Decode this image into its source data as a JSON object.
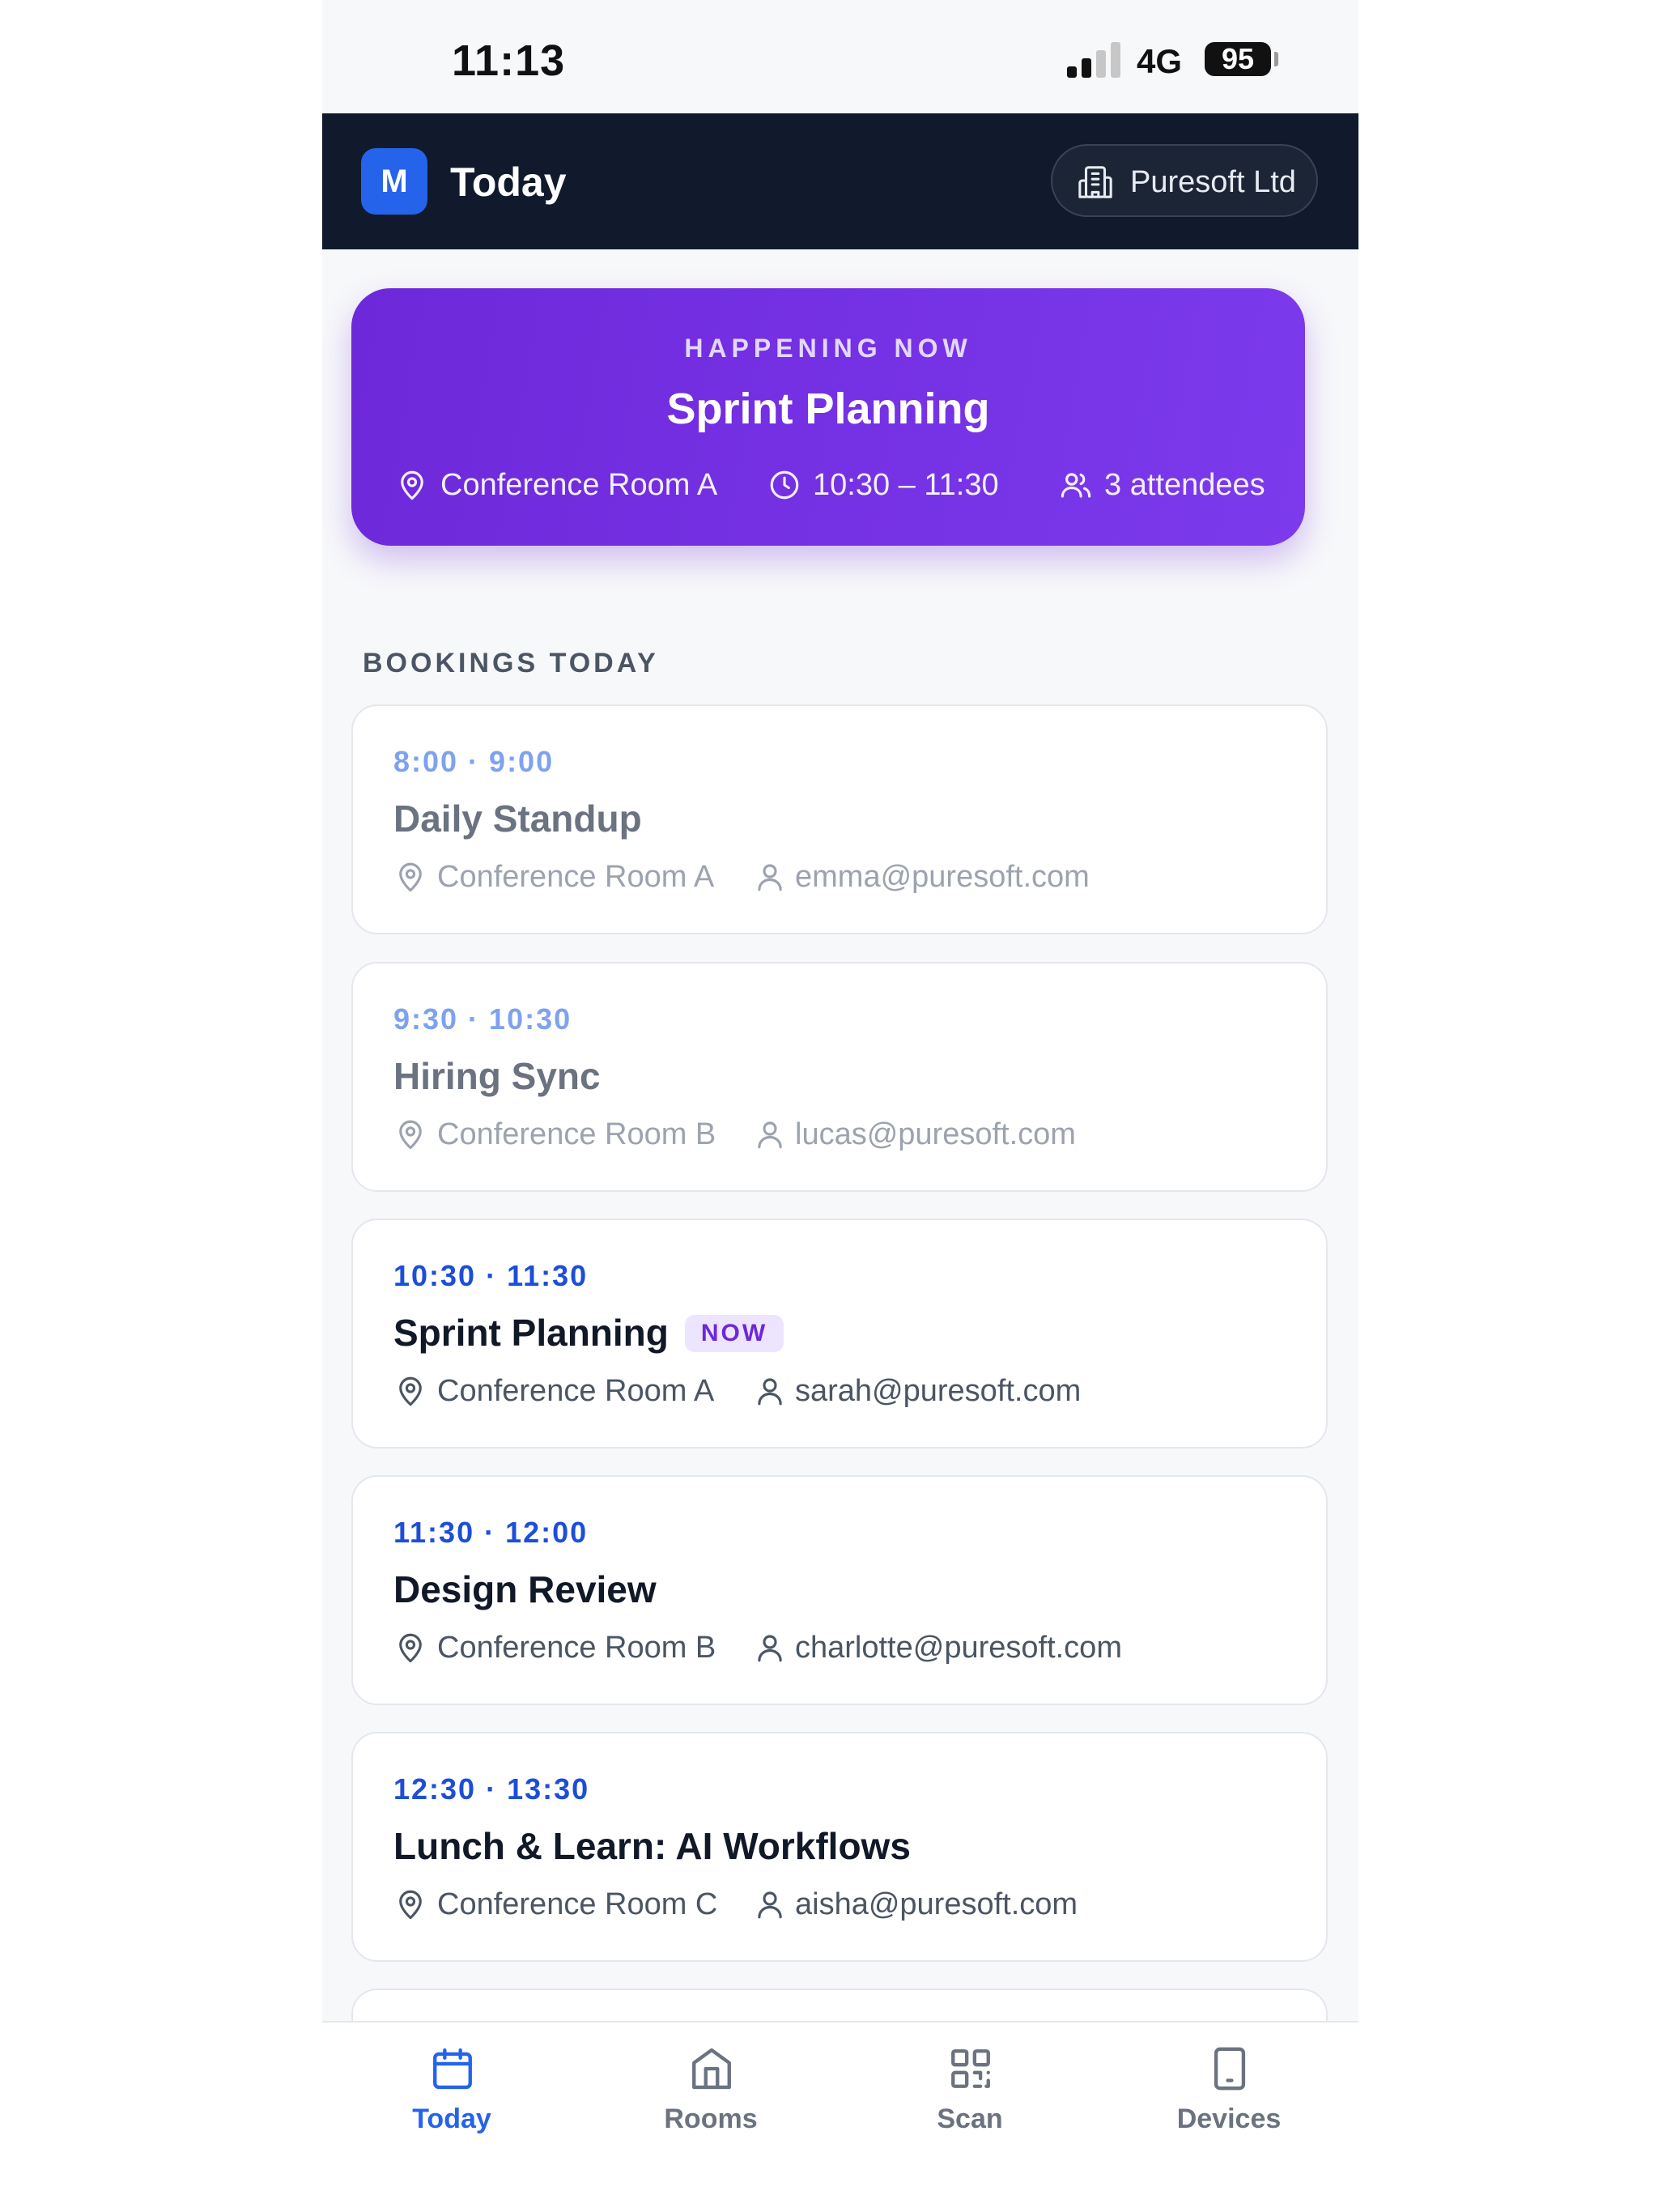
{
  "status_bar": {
    "time": "11:13",
    "network": "4G",
    "battery": "95"
  },
  "header": {
    "logo_letter": "M",
    "title": "Today",
    "organization": "Puresoft Ltd"
  },
  "happening_now": {
    "eyebrow": "HAPPENING NOW",
    "title": "Sprint Planning",
    "room": "Conference Room A",
    "time": "10:30 – 11:30",
    "attendees": "3 attendees"
  },
  "bookings": {
    "section_title": "BOOKINGS TODAY",
    "items": [
      {
        "time": "8:00 · 9:00",
        "title": "Daily Standup",
        "room": "Conference Room A",
        "organizer": "emma@puresoft.com",
        "badge": ""
      },
      {
        "time": "9:30 · 10:30",
        "title": "Hiring Sync",
        "room": "Conference Room B",
        "organizer": "lucas@puresoft.com",
        "badge": ""
      },
      {
        "time": "10:30 · 11:30",
        "title": "Sprint Planning",
        "room": "Conference Room A",
        "organizer": "sarah@puresoft.com",
        "badge": "NOW"
      },
      {
        "time": "11:30 · 12:00",
        "title": "Design Review",
        "room": "Conference Room B",
        "organizer": "charlotte@puresoft.com",
        "badge": ""
      },
      {
        "time": "12:30 · 13:30",
        "title": "Lunch & Learn: AI Workflows",
        "room": "Conference Room C",
        "organizer": "aisha@puresoft.com",
        "badge": ""
      }
    ]
  },
  "tab_bar": {
    "items": [
      {
        "label": "Today",
        "icon": "calendar-icon",
        "active": true
      },
      {
        "label": "Rooms",
        "icon": "building-door-icon",
        "active": false
      },
      {
        "label": "Scan",
        "icon": "qr-code-icon",
        "active": false
      },
      {
        "label": "Devices",
        "icon": "tablet-icon",
        "active": false
      }
    ]
  },
  "colors": {
    "accent": "#2563eb",
    "header_bg": "#111a2c",
    "hero_start": "#6d28d9",
    "hero_end": "#7c3aed",
    "badge_bg": "#ede5ff"
  }
}
